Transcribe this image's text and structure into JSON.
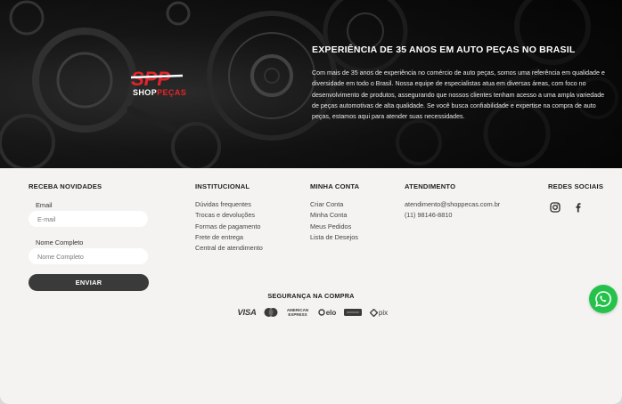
{
  "hero": {
    "logo_mark": "SPP",
    "logo_brand_a": "SHOP",
    "logo_brand_b": "PEÇAS",
    "title": "EXPERIÊNCIA DE 35 ANOS EM AUTO PEÇAS NO BRASIL",
    "text": "Com mais de 35 anos de experiência no comércio de auto peças, somos uma referência em qualidade e diversidade em todo o Brasil. Nossa equipe de especialistas atua em diversas áreas, com foco no desenvolvimento de produtos, assegurando que nossos clientes tenham acesso a uma ampla variedade de peças automotivas de alta qualidade. Se você busca confiabilidade e expertise na compra de auto peças, estamos aqui para atender suas necessidades."
  },
  "newsletter": {
    "title": "RECEBA NOVIDADES",
    "email_label": "Email",
    "email_placeholder": "E-mail",
    "email_value": "",
    "name_label": "Nome Completo",
    "name_placeholder": "Nome Completo",
    "name_value": "",
    "submit_label": "ENVIAR"
  },
  "institucional": {
    "title": "INSTITUCIONAL",
    "items": [
      "Dúvidas frequentes",
      "Trocas e devoluções",
      "Formas de pagamento",
      "Frete de entrega",
      "Central de atendimento"
    ]
  },
  "minha_conta": {
    "title": "MINHA CONTA",
    "items": [
      "Criar Conta",
      "Minha Conta",
      "Meus Pedidos",
      "Lista de Desejos"
    ]
  },
  "atendimento": {
    "title": "ATENDIMENTO",
    "email": "atendimento@shoppecas.com.br",
    "phone": "(11) 98146-8810"
  },
  "redes_sociais": {
    "title": "REDES SOCIAIS",
    "icons": [
      "instagram-icon",
      "facebook-icon"
    ]
  },
  "seguranca": {
    "title": "SEGURANÇA NA COMPRA",
    "payments": {
      "visa": "VISA",
      "amex_top": "AMERICAN",
      "amex_bottom": "EXPRESS",
      "elo": "elo",
      "pix": "pix"
    }
  },
  "colors": {
    "hero_bg": "#141414",
    "footer_bg": "#f4f3f1",
    "button_bg": "#3a3a3a",
    "brand_red": "#e3242b",
    "whatsapp_green": "#25c24b"
  }
}
